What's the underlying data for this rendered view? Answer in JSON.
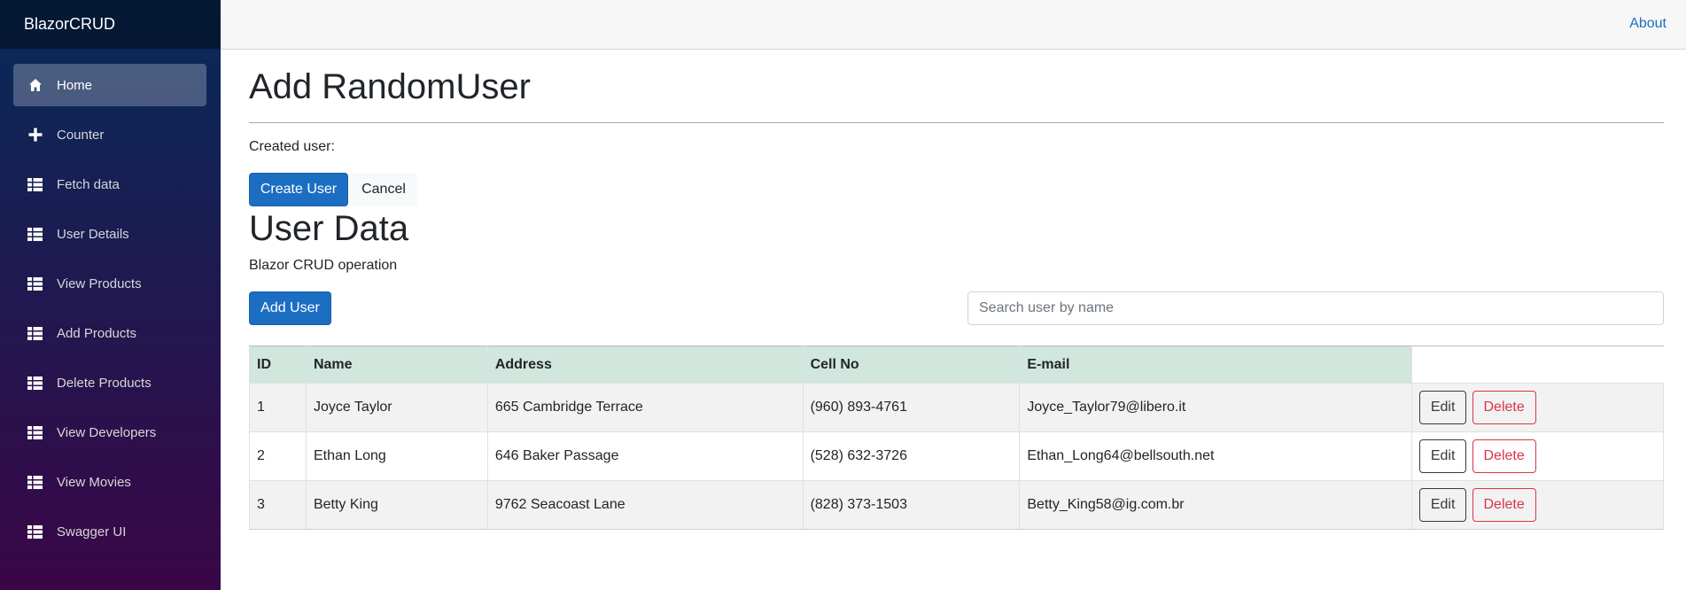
{
  "app": {
    "brand": "BlazorCRUD"
  },
  "sidebar": {
    "items": [
      {
        "label": "Home",
        "icon": "home-icon",
        "active": true
      },
      {
        "label": "Counter",
        "icon": "plus-icon",
        "active": false
      },
      {
        "label": "Fetch data",
        "icon": "list-icon",
        "active": false
      },
      {
        "label": "User Details",
        "icon": "list-icon",
        "active": false
      },
      {
        "label": "View Products",
        "icon": "list-icon",
        "active": false
      },
      {
        "label": "Add Products",
        "icon": "list-icon",
        "active": false
      },
      {
        "label": "Delete Products",
        "icon": "list-icon",
        "active": false
      },
      {
        "label": "View Developers",
        "icon": "list-icon",
        "active": false
      },
      {
        "label": "View Movies",
        "icon": "list-icon",
        "active": false
      },
      {
        "label": "Swagger UI",
        "icon": "list-icon",
        "active": false
      }
    ]
  },
  "topbar": {
    "about": "About"
  },
  "main": {
    "title": "Add RandomUser",
    "created_label": "Created user:",
    "create_button": "Create User",
    "cancel_button": "Cancel",
    "section_title": "User Data",
    "section_subtitle": "Blazor CRUD operation",
    "add_button": "Add User",
    "search_placeholder": "Search user by name"
  },
  "table": {
    "columns": [
      "ID",
      "Name",
      "Address",
      "Cell No",
      "E-mail"
    ],
    "rows": [
      {
        "id": "1",
        "name": "Joyce Taylor",
        "address": "665 Cambridge Terrace",
        "cell": "(960) 893-4761",
        "email": "Joyce_Taylor79@libero.it"
      },
      {
        "id": "2",
        "name": "Ethan Long",
        "address": "646 Baker Passage",
        "cell": "(528) 632-3726",
        "email": "Ethan_Long64@bellsouth.net"
      },
      {
        "id": "3",
        "name": "Betty King",
        "address": "9762 Seacoast Lane",
        "cell": "(828) 373-1503",
        "email": "Betty_King58@ig.com.br"
      }
    ],
    "edit_label": "Edit",
    "delete_label": "Delete"
  },
  "colors": {
    "primary": "#1b6ec2",
    "header_green": "#d1e7dd",
    "danger": "#dc3545",
    "sidebar_top": "#062b59",
    "sidebar_bottom": "#3a0647"
  }
}
